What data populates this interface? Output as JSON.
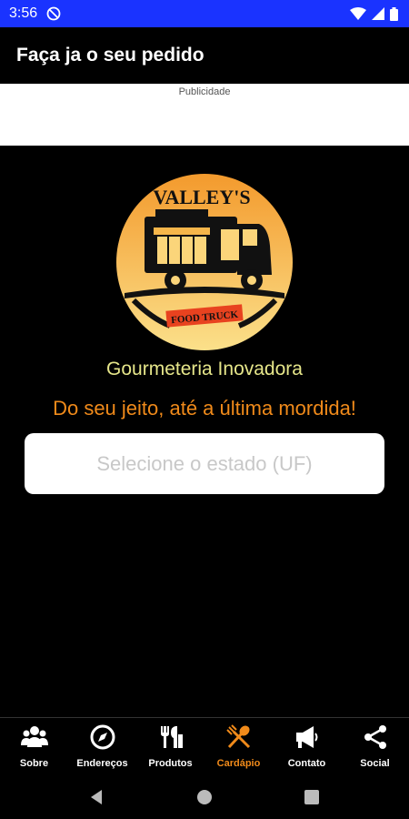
{
  "status_bar": {
    "time": "3:56"
  },
  "app_bar": {
    "title": "Faça ja o seu pedido"
  },
  "ad": {
    "label": "Publicidade"
  },
  "logo": {
    "brand_text": "VALLEY'S",
    "badge_text": "FOOD TRUCK"
  },
  "taglines": {
    "line1": "Gourmeteria Inovadora",
    "line2": "Do seu jeito, até a última mordida!"
  },
  "state_select": {
    "placeholder": "Selecione o estado (UF)"
  },
  "bottom_nav": {
    "items": [
      {
        "label": "Sobre",
        "icon": "people-icon"
      },
      {
        "label": "Endereços",
        "icon": "compass-icon"
      },
      {
        "label": "Produtos",
        "icon": "utensils-icon"
      },
      {
        "label": "Cardápio",
        "icon": "spoon-fork-icon",
        "active": true
      },
      {
        "label": "Contato",
        "icon": "megaphone-icon"
      },
      {
        "label": "Social",
        "icon": "share-icon"
      }
    ]
  },
  "colors": {
    "status_bar": "#1a33ff",
    "accent": "#f08a1a",
    "tagline_yellow": "#e6e68a"
  }
}
